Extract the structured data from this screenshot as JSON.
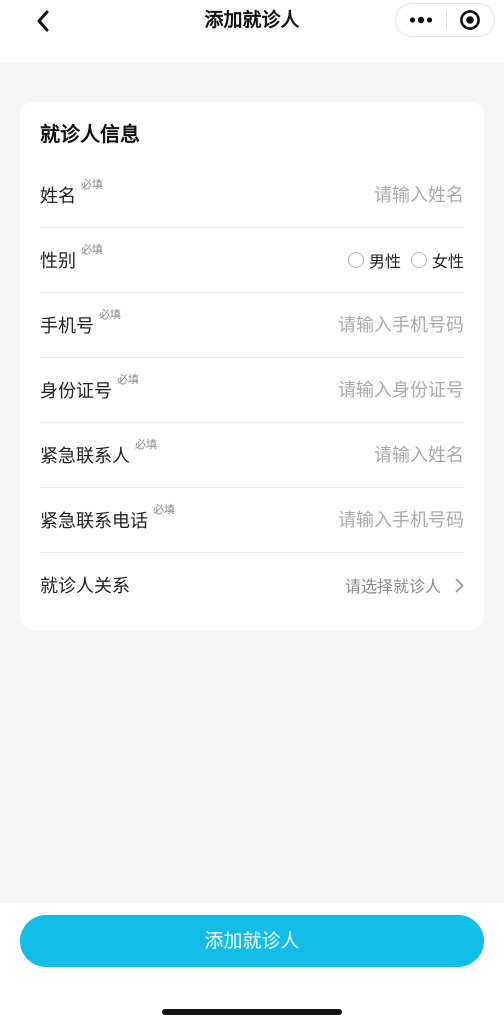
{
  "nav": {
    "title": "添加就诊人",
    "back_icon": "chevron-left-icon",
    "more_icon": "more-dots-icon",
    "close_icon": "target-circle-icon"
  },
  "form": {
    "section_title": "就诊人信息",
    "required_tag": "必填",
    "name": {
      "label": "姓名",
      "placeholder": "请输入姓名",
      "value": ""
    },
    "gender": {
      "label": "性别",
      "options": [
        "男性",
        "女性"
      ],
      "selected": null
    },
    "phone": {
      "label": "手机号",
      "placeholder": "请输入手机号码",
      "value": ""
    },
    "id_number": {
      "label": "身份证号",
      "placeholder": "请输入身份证号",
      "value": ""
    },
    "emergency_name": {
      "label": "紧急联系人",
      "placeholder": "请输入姓名",
      "value": ""
    },
    "emergency_phone": {
      "label": "紧急联系电话",
      "placeholder": "请输入手机号码",
      "value": ""
    },
    "relation": {
      "label": "就诊人关系",
      "placeholder": "请选择就诊人",
      "arrow_icon": "chevron-right-icon"
    }
  },
  "footer": {
    "submit_label": "添加就诊人"
  },
  "colors": {
    "primary": "#12bde8",
    "background": "#f5f5f5",
    "placeholder": "#a9a9a9"
  }
}
